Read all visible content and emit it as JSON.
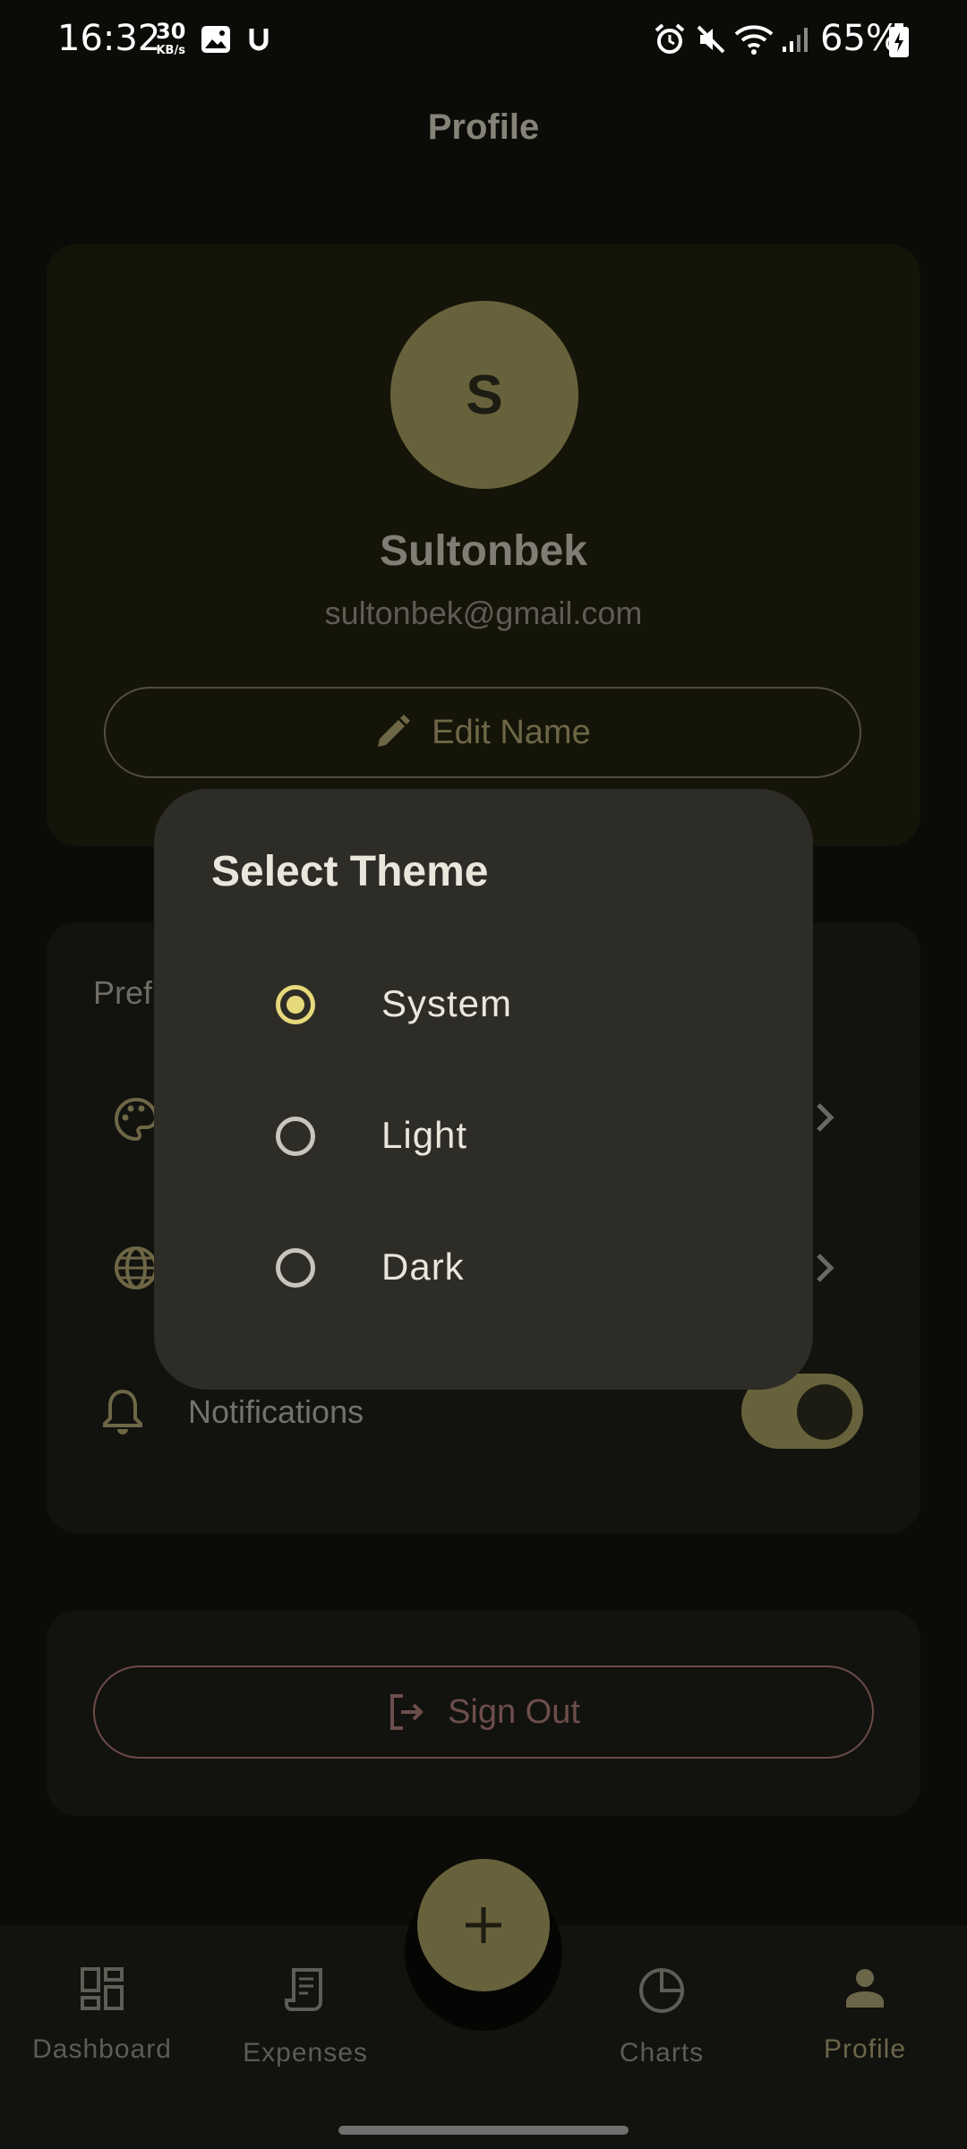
{
  "status_bar": {
    "time": "16:32",
    "net_speed_value": "30",
    "net_speed_unit": "KB/s",
    "battery": "65%",
    "icons": [
      "image-icon",
      "u-app-icon",
      "alarm-icon",
      "mute-icon",
      "wifi-icon",
      "signal-icon",
      "battery-charging-icon"
    ]
  },
  "header": {
    "title": "Profile"
  },
  "profile": {
    "avatar_letter": "S",
    "name": "Sultonbek",
    "email": "sultonbek@gmail.com",
    "edit_label": "Edit Name"
  },
  "preferences": {
    "title_visible": "Pref",
    "notifications_label": "Notifications",
    "notifications_enabled": true
  },
  "sign_out_label": "Sign Out",
  "dialog": {
    "title": "Select Theme",
    "options": [
      {
        "label": "System",
        "selected": true
      },
      {
        "label": "Light",
        "selected": false
      },
      {
        "label": "Dark",
        "selected": false
      }
    ]
  },
  "nav": {
    "items": [
      {
        "label": "Dashboard",
        "icon": "dashboard-icon"
      },
      {
        "label": "Expenses",
        "icon": "receipt-icon"
      },
      {
        "label": "Charts",
        "icon": "pie-chart-icon"
      },
      {
        "label": "Profile",
        "icon": "person-icon",
        "active": true
      }
    ],
    "fab_icon": "plus-icon"
  },
  "colors": {
    "accent": "#e6d97b",
    "accent_dim": "#67623b",
    "dialog_bg": "#2e2c27",
    "danger_dim": "#6d4e4c"
  }
}
